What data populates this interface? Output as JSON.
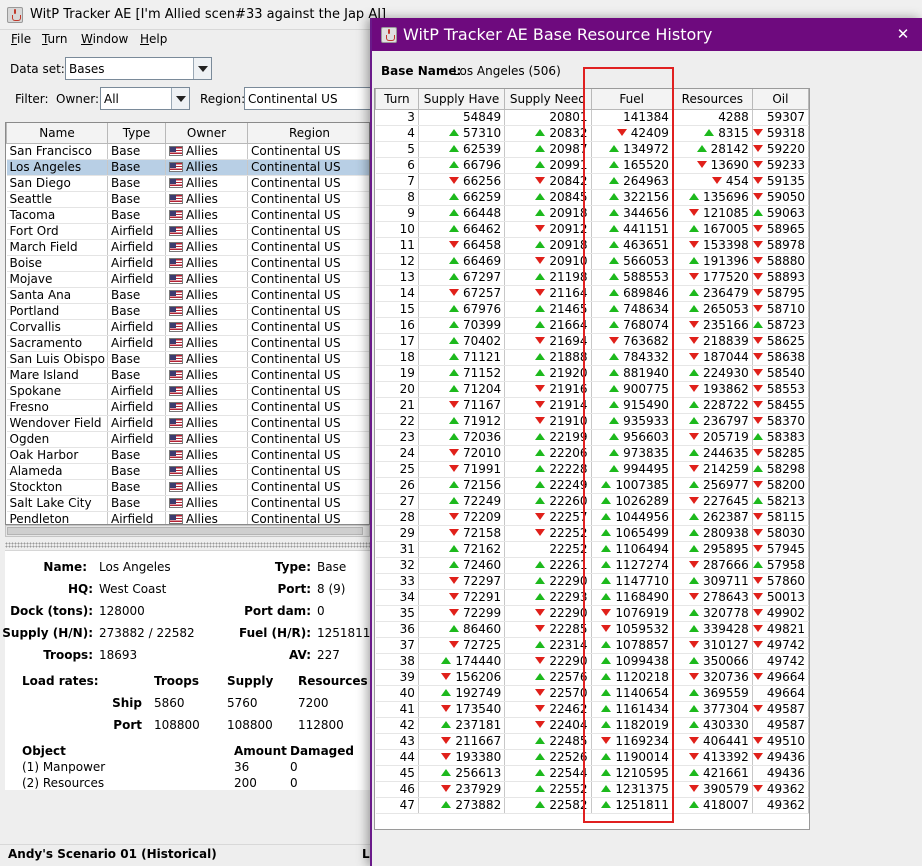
{
  "main_window": {
    "title": "WitP Tracker AE [I'm Allied scen#33 against the Jap AI]",
    "menu": [
      {
        "mnemonic": "F",
        "rest": "ile"
      },
      {
        "mnemonic": "T",
        "rest": "urn"
      },
      {
        "mnemonic": "W",
        "rest": "indow"
      },
      {
        "mnemonic": "H",
        "rest": "elp"
      }
    ],
    "dataset_label": "Data set:",
    "dataset_value": "Bases",
    "filter_label": "Filter:",
    "owner_label": "Owner:",
    "owner_value": "All",
    "region_label": "Region:",
    "region_value": "Continental US",
    "columns": [
      "Name",
      "Type",
      "Owner",
      "Region"
    ],
    "rows": [
      [
        "San Francisco",
        "Base",
        "Allies",
        "Continental US"
      ],
      [
        "Los Angeles",
        "Base",
        "Allies",
        "Continental US"
      ],
      [
        "San Diego",
        "Base",
        "Allies",
        "Continental US"
      ],
      [
        "Seattle",
        "Base",
        "Allies",
        "Continental US"
      ],
      [
        "Tacoma",
        "Base",
        "Allies",
        "Continental US"
      ],
      [
        "Fort Ord",
        "Airfield",
        "Allies",
        "Continental US"
      ],
      [
        "March Field",
        "Airfield",
        "Allies",
        "Continental US"
      ],
      [
        "Boise",
        "Airfield",
        "Allies",
        "Continental US"
      ],
      [
        "Mojave",
        "Airfield",
        "Allies",
        "Continental US"
      ],
      [
        "Santa Ana",
        "Base",
        "Allies",
        "Continental US"
      ],
      [
        "Portland",
        "Base",
        "Allies",
        "Continental US"
      ],
      [
        "Corvallis",
        "Airfield",
        "Allies",
        "Continental US"
      ],
      [
        "Sacramento",
        "Airfield",
        "Allies",
        "Continental US"
      ],
      [
        "San Luis Obispo",
        "Base",
        "Allies",
        "Continental US"
      ],
      [
        "Mare Island",
        "Base",
        "Allies",
        "Continental US"
      ],
      [
        "Spokane",
        "Airfield",
        "Allies",
        "Continental US"
      ],
      [
        "Fresno",
        "Airfield",
        "Allies",
        "Continental US"
      ],
      [
        "Wendover Field",
        "Airfield",
        "Allies",
        "Continental US"
      ],
      [
        "Ogden",
        "Airfield",
        "Allies",
        "Continental US"
      ],
      [
        "Oak Harbor",
        "Base",
        "Allies",
        "Continental US"
      ],
      [
        "Alameda",
        "Base",
        "Allies",
        "Continental US"
      ],
      [
        "Stockton",
        "Base",
        "Allies",
        "Continental US"
      ],
      [
        "Salt Lake City",
        "Base",
        "Allies",
        "Continental US"
      ],
      [
        "Pendleton",
        "Airfield",
        "Allies",
        "Continental US"
      ]
    ],
    "selected_row": 1,
    "detail": {
      "name_label": "Name:",
      "name_value": "Los Angeles",
      "type_label": "Type:",
      "type_value": "Base",
      "hq_label": "HQ:",
      "hq_value": "West Coast",
      "port_label": "Port:",
      "port_value": "8 (9)",
      "dock_label": "Dock (tons):",
      "dock_value": "128000",
      "portdam_label": "Port dam:",
      "portdam_value": "0",
      "supply_label": "Supply (H/N):",
      "supply_value": "273882 / 22582",
      "fuel_label": "Fuel (H/R):",
      "fuel_value": "1251811",
      "troops_label": "Troops:",
      "troops_value": "18693",
      "av_label": "AV:",
      "av_value": "227",
      "load_rates_label": "Load rates:",
      "load_cols": [
        "Troops",
        "Supply",
        "Resources"
      ],
      "ship_label": "Ship",
      "ship_values": [
        "5860",
        "5760",
        "7200"
      ],
      "port_row_label": "Port",
      "port_values": [
        "108800",
        "108800",
        "112800"
      ],
      "object_cols": [
        "Object",
        "Amount",
        "Damaged"
      ],
      "objects": [
        [
          "(1) Manpower",
          "36",
          "0"
        ],
        [
          "(2) Resources",
          "200",
          "0"
        ]
      ]
    },
    "status_text": "Andy's Scenario 01 (Historical)",
    "status_right": "L"
  },
  "history_window": {
    "title": "WitP Tracker AE Base Resource History",
    "close_icon": "close-icon",
    "base_name_label": "Base Name:",
    "base_name_value": "Los Angeles (506)",
    "columns": [
      "Turn",
      "Supply Have",
      "Supply Need",
      "Fuel",
      "Resources",
      "Oil"
    ],
    "rows": [
      [
        "3",
        "",
        "54849",
        "",
        "20801",
        "",
        "141384",
        "",
        "4288",
        "",
        "59307"
      ],
      [
        "4",
        "u",
        "57310",
        "u",
        "20832",
        "d",
        "42409",
        "u",
        "8315",
        "d",
        "59318"
      ],
      [
        "5",
        "u",
        "62539",
        "u",
        "20987",
        "u",
        "134972",
        "u",
        "28142",
        "d",
        "59220"
      ],
      [
        "6",
        "u",
        "66796",
        "u",
        "20991",
        "u",
        "165520",
        "d",
        "13690",
        "d",
        "59233"
      ],
      [
        "7",
        "d",
        "66256",
        "d",
        "20842",
        "u",
        "264963",
        "d",
        "454",
        "d",
        "59135"
      ],
      [
        "8",
        "u",
        "66259",
        "u",
        "20845",
        "u",
        "322156",
        "u",
        "135696",
        "d",
        "59050"
      ],
      [
        "9",
        "u",
        "66448",
        "u",
        "20918",
        "u",
        "344656",
        "d",
        "121085",
        "u",
        "59063"
      ],
      [
        "10",
        "u",
        "66462",
        "d",
        "20912",
        "u",
        "441151",
        "u",
        "167005",
        "d",
        "58965"
      ],
      [
        "11",
        "d",
        "66458",
        "u",
        "20918",
        "u",
        "463651",
        "d",
        "153398",
        "d",
        "58978"
      ],
      [
        "12",
        "u",
        "66469",
        "d",
        "20910",
        "u",
        "566053",
        "u",
        "191396",
        "d",
        "58880"
      ],
      [
        "13",
        "u",
        "67297",
        "u",
        "21198",
        "u",
        "588553",
        "d",
        "177520",
        "d",
        "58893"
      ],
      [
        "14",
        "d",
        "67257",
        "d",
        "21164",
        "u",
        "689846",
        "u",
        "236479",
        "d",
        "58795"
      ],
      [
        "15",
        "u",
        "67976",
        "u",
        "21465",
        "u",
        "748634",
        "u",
        "265053",
        "d",
        "58710"
      ],
      [
        "16",
        "u",
        "70399",
        "u",
        "21664",
        "u",
        "768074",
        "d",
        "235166",
        "u",
        "58723"
      ],
      [
        "17",
        "u",
        "70402",
        "d",
        "21694",
        "d",
        "763682",
        "d",
        "218839",
        "d",
        "58625"
      ],
      [
        "18",
        "u",
        "71121",
        "u",
        "21888",
        "u",
        "784332",
        "d",
        "187044",
        "d",
        "58638"
      ],
      [
        "19",
        "u",
        "71152",
        "u",
        "21920",
        "u",
        "881940",
        "u",
        "224930",
        "d",
        "58540"
      ],
      [
        "20",
        "u",
        "71204",
        "d",
        "21916",
        "u",
        "900775",
        "d",
        "193862",
        "d",
        "58553"
      ],
      [
        "21",
        "d",
        "71167",
        "d",
        "21914",
        "u",
        "915490",
        "u",
        "228722",
        "d",
        "58455"
      ],
      [
        "22",
        "u",
        "71912",
        "d",
        "21910",
        "u",
        "935933",
        "u",
        "236797",
        "d",
        "58370"
      ],
      [
        "23",
        "u",
        "72036",
        "u",
        "22199",
        "u",
        "956603",
        "d",
        "205719",
        "u",
        "58383"
      ],
      [
        "24",
        "d",
        "72010",
        "u",
        "22206",
        "u",
        "973835",
        "u",
        "244635",
        "d",
        "58285"
      ],
      [
        "25",
        "d",
        "71991",
        "u",
        "22228",
        "u",
        "994495",
        "d",
        "214259",
        "u",
        "58298"
      ],
      [
        "26",
        "u",
        "72156",
        "u",
        "22249",
        "u",
        "1007385",
        "u",
        "256977",
        "d",
        "58200"
      ],
      [
        "27",
        "u",
        "72249",
        "u",
        "22260",
        "u",
        "1026289",
        "d",
        "227645",
        "u",
        "58213"
      ],
      [
        "28",
        "d",
        "72209",
        "d",
        "22257",
        "u",
        "1044956",
        "u",
        "262387",
        "d",
        "58115"
      ],
      [
        "29",
        "d",
        "72158",
        "d",
        "22252",
        "u",
        "1065499",
        "u",
        "280938",
        "d",
        "58030"
      ],
      [
        "31",
        "u",
        "72162",
        "",
        "22252",
        "u",
        "1106494",
        "u",
        "295895",
        "d",
        "57945"
      ],
      [
        "32",
        "u",
        "72460",
        "u",
        "22261",
        "u",
        "1127274",
        "d",
        "287666",
        "u",
        "57958"
      ],
      [
        "33",
        "d",
        "72297",
        "u",
        "22290",
        "u",
        "1147710",
        "u",
        "309711",
        "d",
        "57860"
      ],
      [
        "34",
        "d",
        "72291",
        "u",
        "22293",
        "u",
        "1168490",
        "d",
        "278643",
        "d",
        "50013"
      ],
      [
        "35",
        "d",
        "72299",
        "d",
        "22290",
        "d",
        "1076919",
        "u",
        "320778",
        "d",
        "49902"
      ],
      [
        "36",
        "u",
        "86460",
        "d",
        "22285",
        "d",
        "1059532",
        "u",
        "339428",
        "d",
        "49821"
      ],
      [
        "37",
        "d",
        "72725",
        "u",
        "22314",
        "u",
        "1078857",
        "d",
        "310127",
        "d",
        "49742"
      ],
      [
        "38",
        "u",
        "174440",
        "d",
        "22290",
        "u",
        "1099438",
        "u",
        "350066",
        "",
        "49742"
      ],
      [
        "39",
        "d",
        "156206",
        "u",
        "22576",
        "u",
        "1120218",
        "d",
        "320736",
        "d",
        "49664"
      ],
      [
        "40",
        "u",
        "192749",
        "d",
        "22570",
        "u",
        "1140654",
        "u",
        "369559",
        "",
        "49664"
      ],
      [
        "41",
        "d",
        "173540",
        "d",
        "22462",
        "u",
        "1161434",
        "u",
        "377304",
        "d",
        "49587"
      ],
      [
        "42",
        "u",
        "237181",
        "d",
        "22404",
        "u",
        "1182019",
        "u",
        "430330",
        "",
        "49587"
      ],
      [
        "43",
        "d",
        "211667",
        "u",
        "22485",
        "d",
        "1169234",
        "d",
        "406441",
        "d",
        "49510"
      ],
      [
        "44",
        "d",
        "193380",
        "u",
        "22526",
        "u",
        "1190014",
        "d",
        "413392",
        "d",
        "49436"
      ],
      [
        "45",
        "u",
        "256613",
        "u",
        "22544",
        "u",
        "1210595",
        "u",
        "421661",
        "",
        "49436"
      ],
      [
        "46",
        "d",
        "237929",
        "u",
        "22552",
        "u",
        "1231375",
        "d",
        "390579",
        "d",
        "49362"
      ],
      [
        "47",
        "u",
        "273882",
        "u",
        "22582",
        "u",
        "1251811",
        "u",
        "418007",
        "",
        "49362"
      ]
    ],
    "colors": {
      "titlebar": "#6e0a7e",
      "up": "#1db91d",
      "down": "#e0201a",
      "highlight": "#e02020"
    }
  }
}
